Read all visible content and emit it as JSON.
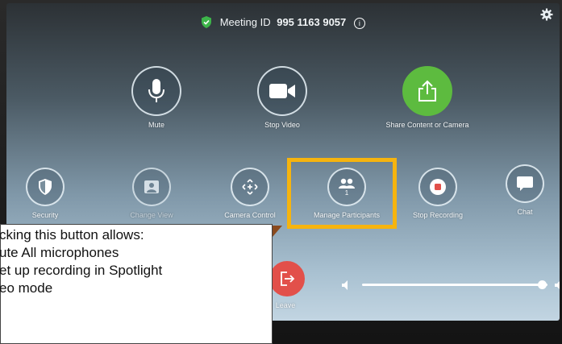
{
  "meeting": {
    "label": "Meeting ID",
    "id": "995 1163 9057",
    "info_glyph": "i"
  },
  "icons": {
    "shield": "shield-check-icon",
    "settings": "gear-icon"
  },
  "colors": {
    "share_green": "#5dbb3f",
    "leave_red": "#e2504a",
    "highlight": "#f6b40e"
  },
  "controls": {
    "mute": "Mute",
    "stop_video": "Stop Video",
    "share": "Share Content or Camera",
    "security": "Security",
    "change_view": "Change View",
    "camera_control": "Camera Control",
    "manage_participants": "Manage Participants",
    "participant_count": "1",
    "stop_recording": "Stop Recording",
    "chat": "Chat",
    "leave": "Leave"
  },
  "volume": {
    "level": 0.97
  },
  "callout": {
    "lines": [
      "cking this button allows:",
      "ute All microphones",
      "et up recording in Spotlight",
      "eo mode"
    ]
  }
}
